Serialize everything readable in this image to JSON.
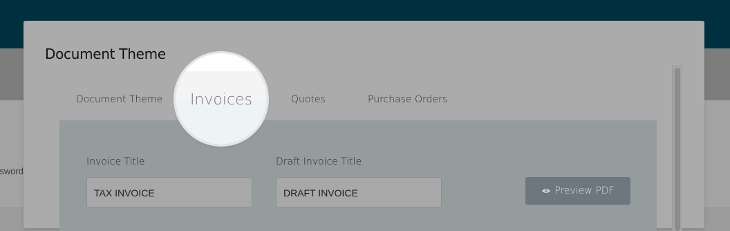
{
  "background": {
    "side_text": "Password"
  },
  "modal": {
    "title": "Document Theme",
    "tabs": [
      {
        "label": "Document Theme"
      },
      {
        "label": "Invoices"
      },
      {
        "label": "Quotes"
      },
      {
        "label": "Purchase Orders"
      }
    ],
    "active_tab": "Invoices",
    "invoice_title_label": "Invoice Title",
    "invoice_title_value": "TAX INVOICE",
    "draft_invoice_title_label": "Draft Invoice Title",
    "draft_invoice_title_value": "DRAFT INVOICE",
    "preview_button_label": "Preview PDF",
    "preview_button_icon": "eye-icon"
  },
  "colors": {
    "topbar": "#00303f",
    "preview_button": "#6c7780",
    "spotlight": "#ffffff"
  }
}
